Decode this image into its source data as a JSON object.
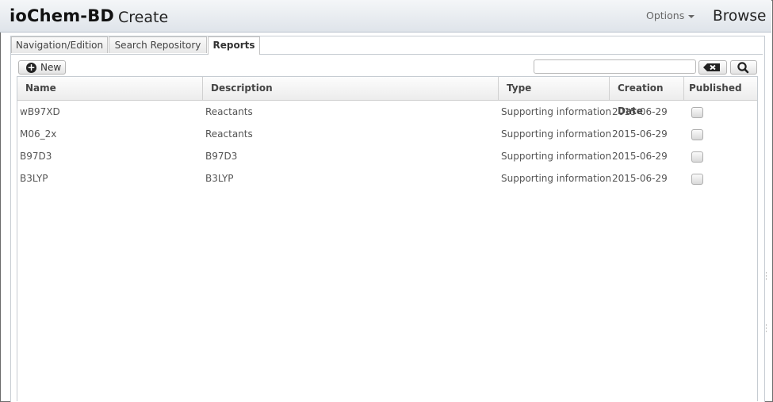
{
  "header": {
    "brand": "ioChem-BD",
    "section": "Create",
    "options_label": "Options",
    "browse_label": "Browse"
  },
  "tabs": [
    {
      "label": "Navigation/Edition",
      "active": false
    },
    {
      "label": "Search Repository",
      "active": false
    },
    {
      "label": "Reports",
      "active": true
    }
  ],
  "toolbar": {
    "new_label": "New",
    "search_value": "",
    "clear_icon": "backspace-icon",
    "search_icon": "magnifier-icon"
  },
  "table": {
    "columns": [
      "Name",
      "Description",
      "Type",
      "Creation Date",
      "Published"
    ],
    "rows": [
      {
        "name": "wB97XD",
        "description": "Reactants",
        "type": "Supporting information",
        "date": "2015-06-29",
        "published": false
      },
      {
        "name": "M06_2x",
        "description": "Reactants",
        "type": "Supporting information",
        "date": "2015-06-29",
        "published": false
      },
      {
        "name": "B97D3",
        "description": "B97D3",
        "type": "Supporting information",
        "date": "2015-06-29",
        "published": false
      },
      {
        "name": "B3LYP",
        "description": "B3LYP",
        "type": "Supporting information",
        "date": "2015-06-29",
        "published": false
      }
    ]
  }
}
